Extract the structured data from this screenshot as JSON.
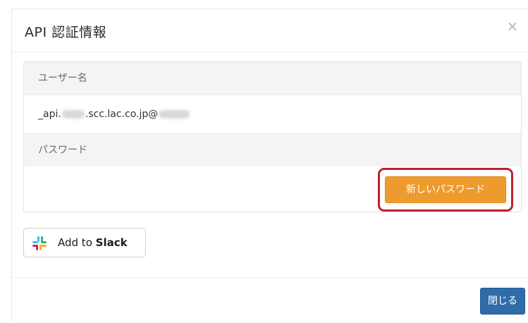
{
  "dialog": {
    "title": "API 認証情報",
    "close_glyph": "×"
  },
  "credentials": {
    "username_label": "ユーザー名",
    "username_prefix": "_api.",
    "username_middle": ".scc.lac.co.jp@",
    "password_label": "パスワード",
    "new_password_button": "新しいパスワード"
  },
  "slack": {
    "icon": "slack-logo-icon",
    "label_prefix": "Add to ",
    "label_bold": "Slack"
  },
  "footer": {
    "close_button": "閉じる"
  },
  "colors": {
    "accent_orange": "#ee9b2e",
    "highlight_red": "#c0202a",
    "primary_blue": "#2f6ca8"
  }
}
